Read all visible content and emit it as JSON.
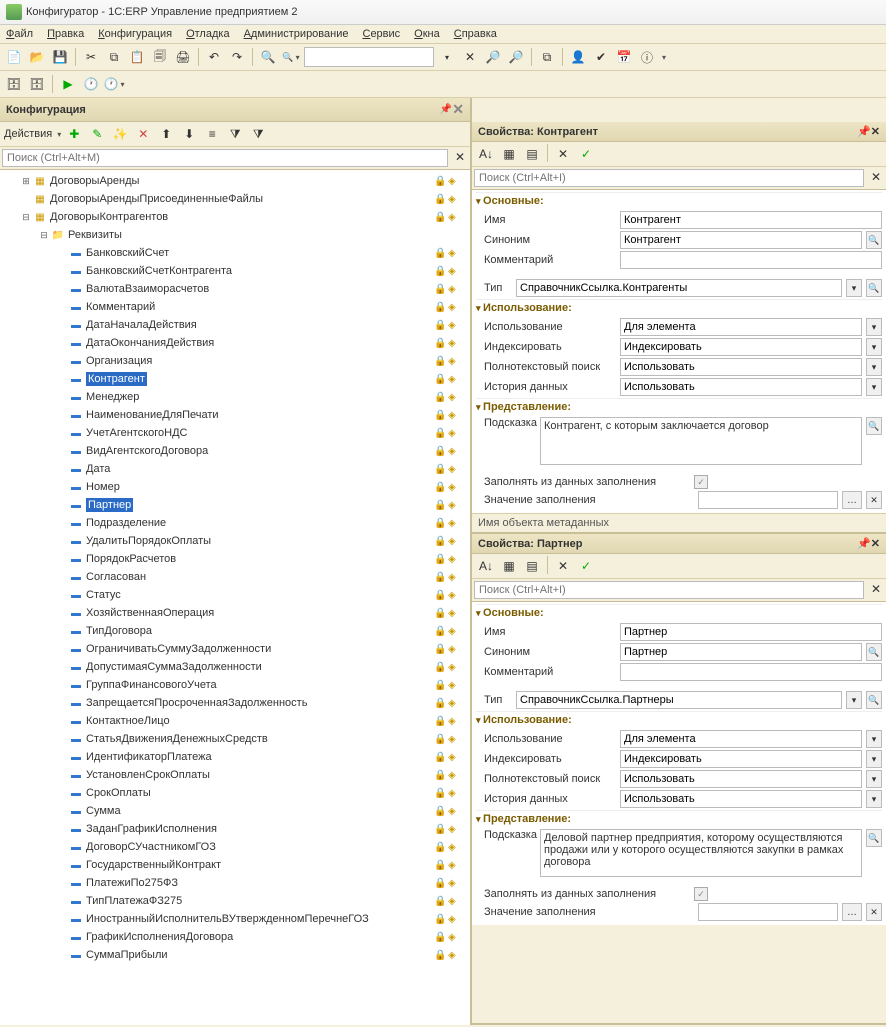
{
  "title": "Конфигуратор - 1C:ERP Управление предприятием 2",
  "menu": [
    "Файл",
    "Правка",
    "Конфигурация",
    "Отладка",
    "Администрирование",
    "Сервис",
    "Окна",
    "Справка"
  ],
  "toolbar1_search_placeholder": "",
  "config_panel": {
    "title": "Конфигурация",
    "actions_label": "Действия",
    "search_placeholder": "Поиск (Ctrl+Alt+M)"
  },
  "tree": [
    {
      "lvl": 0,
      "exp": "+",
      "icon": "cat",
      "label": "ДоговорыАренды",
      "lock": true,
      "cube": true
    },
    {
      "lvl": 0,
      "exp": "",
      "icon": "cat",
      "label": "ДоговорыАрендыПрисоединенныеФайлы",
      "lock": true,
      "cube": true
    },
    {
      "lvl": 0,
      "exp": "-",
      "icon": "cat",
      "label": "ДоговорыКонтрагентов",
      "lock": true,
      "cube": true
    },
    {
      "lvl": 1,
      "exp": "-",
      "icon": "folder",
      "label": "Реквизиты",
      "lock": false,
      "cube": false
    },
    {
      "lvl": 2,
      "exp": "",
      "icon": "attr",
      "label": "БанковскийСчет",
      "lock": true,
      "cube": true
    },
    {
      "lvl": 2,
      "exp": "",
      "icon": "attr",
      "label": "БанковскийСчетКонтрагента",
      "lock": true,
      "cube": true
    },
    {
      "lvl": 2,
      "exp": "",
      "icon": "attr",
      "label": "ВалютаВзаиморасчетов",
      "lock": true,
      "cube": true
    },
    {
      "lvl": 2,
      "exp": "",
      "icon": "attr",
      "label": "Комментарий",
      "lock": true,
      "cube": true
    },
    {
      "lvl": 2,
      "exp": "",
      "icon": "attr",
      "label": "ДатаНачалаДействия",
      "lock": true,
      "cube": true
    },
    {
      "lvl": 2,
      "exp": "",
      "icon": "attr",
      "label": "ДатаОкончанияДействия",
      "lock": true,
      "cube": true
    },
    {
      "lvl": 2,
      "exp": "",
      "icon": "attr",
      "label": "Организация",
      "lock": true,
      "cube": true
    },
    {
      "lvl": 2,
      "exp": "",
      "icon": "attr",
      "label": "Контрагент",
      "lock": true,
      "cube": true,
      "sel": true
    },
    {
      "lvl": 2,
      "exp": "",
      "icon": "attr",
      "label": "Менеджер",
      "lock": true,
      "cube": true
    },
    {
      "lvl": 2,
      "exp": "",
      "icon": "attr",
      "label": "НаименованиеДляПечати",
      "lock": true,
      "cube": true
    },
    {
      "lvl": 2,
      "exp": "",
      "icon": "attr",
      "label": "УчетАгентскогоНДС",
      "lock": true,
      "cube": true
    },
    {
      "lvl": 2,
      "exp": "",
      "icon": "attr",
      "label": "ВидАгентскогоДоговора",
      "lock": true,
      "cube": true
    },
    {
      "lvl": 2,
      "exp": "",
      "icon": "attr",
      "label": "Дата",
      "lock": true,
      "cube": true
    },
    {
      "lvl": 2,
      "exp": "",
      "icon": "attr",
      "label": "Номер",
      "lock": true,
      "cube": true
    },
    {
      "lvl": 2,
      "exp": "",
      "icon": "attr",
      "label": "Партнер",
      "lock": true,
      "cube": true,
      "sel": true
    },
    {
      "lvl": 2,
      "exp": "",
      "icon": "attr",
      "label": "Подразделение",
      "lock": true,
      "cube": true
    },
    {
      "lvl": 2,
      "exp": "",
      "icon": "attr",
      "label": "УдалитьПорядокОплаты",
      "lock": true,
      "cube": true
    },
    {
      "lvl": 2,
      "exp": "",
      "icon": "attr",
      "label": "ПорядокРасчетов",
      "lock": true,
      "cube": true
    },
    {
      "lvl": 2,
      "exp": "",
      "icon": "attr",
      "label": "Согласован",
      "lock": true,
      "cube": true
    },
    {
      "lvl": 2,
      "exp": "",
      "icon": "attr",
      "label": "Статус",
      "lock": true,
      "cube": true
    },
    {
      "lvl": 2,
      "exp": "",
      "icon": "attr",
      "label": "ХозяйственнаяОперация",
      "lock": true,
      "cube": true
    },
    {
      "lvl": 2,
      "exp": "",
      "icon": "attr",
      "label": "ТипДоговора",
      "lock": true,
      "cube": true
    },
    {
      "lvl": 2,
      "exp": "",
      "icon": "attr",
      "label": "ОграничиватьСуммуЗадолженности",
      "lock": true,
      "cube": true
    },
    {
      "lvl": 2,
      "exp": "",
      "icon": "attr",
      "label": "ДопустимаяСуммаЗадолженности",
      "lock": true,
      "cube": true
    },
    {
      "lvl": 2,
      "exp": "",
      "icon": "attr",
      "label": "ГруппаФинансовогоУчета",
      "lock": true,
      "cube": true
    },
    {
      "lvl": 2,
      "exp": "",
      "icon": "attr",
      "label": "ЗапрещаетсяПросроченнаяЗадолженность",
      "lock": true,
      "cube": true
    },
    {
      "lvl": 2,
      "exp": "",
      "icon": "attr",
      "label": "КонтактноеЛицо",
      "lock": true,
      "cube": true
    },
    {
      "lvl": 2,
      "exp": "",
      "icon": "attr",
      "label": "СтатьяДвиженияДенежныхСредств",
      "lock": true,
      "cube": true
    },
    {
      "lvl": 2,
      "exp": "",
      "icon": "attr",
      "label": "ИдентификаторПлатежа",
      "lock": true,
      "cube": true
    },
    {
      "lvl": 2,
      "exp": "",
      "icon": "attr",
      "label": "УстановленСрокОплаты",
      "lock": true,
      "cube": true
    },
    {
      "lvl": 2,
      "exp": "",
      "icon": "attr",
      "label": "СрокОплаты",
      "lock": true,
      "cube": true
    },
    {
      "lvl": 2,
      "exp": "",
      "icon": "attr",
      "label": "Сумма",
      "lock": true,
      "cube": true
    },
    {
      "lvl": 2,
      "exp": "",
      "icon": "attr",
      "label": "ЗаданГрафикИсполнения",
      "lock": true,
      "cube": true
    },
    {
      "lvl": 2,
      "exp": "",
      "icon": "attr",
      "label": "ДоговорСУчастникомГОЗ",
      "lock": true,
      "cube": true
    },
    {
      "lvl": 2,
      "exp": "",
      "icon": "attr",
      "label": "ГосударственныйКонтракт",
      "lock": true,
      "cube": true
    },
    {
      "lvl": 2,
      "exp": "",
      "icon": "attr",
      "label": "ПлатежиПо275ФЗ",
      "lock": true,
      "cube": true
    },
    {
      "lvl": 2,
      "exp": "",
      "icon": "attr",
      "label": "ТипПлатежаФЗ275",
      "lock": true,
      "cube": true
    },
    {
      "lvl": 2,
      "exp": "",
      "icon": "attr",
      "label": "ИностранныйИсполнительВУтвержденномПеречнеГОЗ",
      "lock": true,
      "cube": true
    },
    {
      "lvl": 2,
      "exp": "",
      "icon": "attr",
      "label": "ГрафикИсполненияДоговора",
      "lock": true,
      "cube": true
    },
    {
      "lvl": 2,
      "exp": "",
      "icon": "attr",
      "label": "СуммаПрибыли",
      "lock": true,
      "cube": true
    }
  ],
  "props1": {
    "title": "Свойства: Контрагент",
    "search_placeholder": "Поиск (Ctrl+Alt+I)",
    "sections": {
      "main": "Основные:",
      "usage": "Использование:",
      "presentation": "Представление:"
    },
    "labels": {
      "name": "Имя",
      "synonym": "Синоним",
      "comment": "Комментарий",
      "type": "Тип",
      "usage": "Использование",
      "index": "Индексировать",
      "fulltext": "Полнотекстовый поиск",
      "history": "История данных",
      "hint": "Подсказка",
      "fill_from": "Заполнять из данных заполнения",
      "fill_val": "Значение заполнения"
    },
    "values": {
      "name": "Контрагент",
      "synonym": "Контрагент",
      "comment": "",
      "type": "СправочникСсылка.Контрагенты",
      "usage": "Для элемента",
      "index": "Индексировать",
      "fulltext": "Использовать",
      "history": "Использовать",
      "hint": "Контрагент, с которым заключается договор",
      "fill_val": ""
    },
    "status": "Имя объекта метаданных"
  },
  "props2": {
    "title": "Свойства: Партнер",
    "search_placeholder": "Поиск (Ctrl+Alt+I)",
    "sections": {
      "main": "Основные:",
      "usage": "Использование:",
      "presentation": "Представление:"
    },
    "labels": {
      "name": "Имя",
      "synonym": "Синоним",
      "comment": "Комментарий",
      "type": "Тип",
      "usage": "Использование",
      "index": "Индексировать",
      "fulltext": "Полнотекстовый поиск",
      "history": "История данных",
      "hint": "Подсказка",
      "fill_from": "Заполнять из данных заполнения",
      "fill_val": "Значение заполнения"
    },
    "values": {
      "name": "Партнер",
      "synonym": "Партнер",
      "comment": "",
      "type": "СправочникСсылка.Партнеры",
      "usage": "Для элемента",
      "index": "Индексировать",
      "fulltext": "Использовать",
      "history": "Использовать",
      "hint": "Деловой партнер предприятия, которому осуществляются продажи или у которого осуществляются закупки в рамках договора",
      "fill_val": ""
    }
  }
}
